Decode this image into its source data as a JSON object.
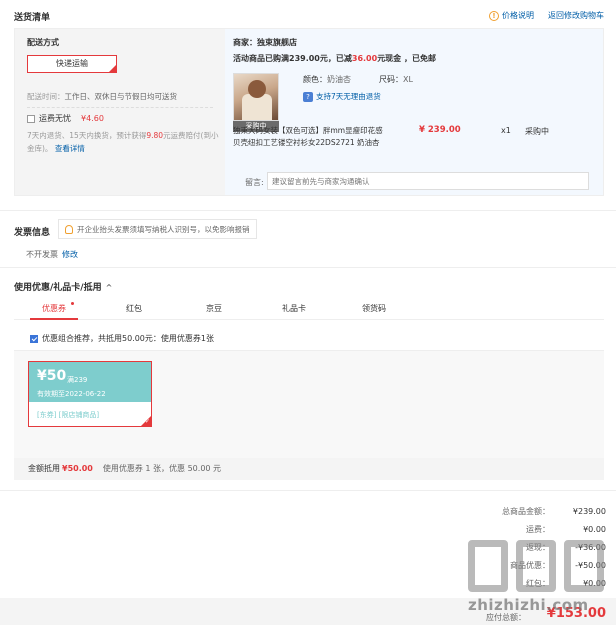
{
  "header": {
    "title": "送货清单",
    "price_info": "价格说明",
    "return_cart": "返回修改购物车"
  },
  "shipping": {
    "title": "配送方式",
    "method": "快递运输",
    "time_label": "配送时间：",
    "time_value": "工作日、双休日与节假日均可送货",
    "worry_label": "运费无忧",
    "worry_price": "¥4.60",
    "worry_desc_1": "7天内退货、15天内换货，预计获得",
    "worry_desc_red": "9.80",
    "worry_desc_2": "元运费赔付(到小金库)。",
    "worry_link": "查看详情"
  },
  "order": {
    "seller": "商家：独束旗舰店",
    "promo_1": "活动商品已购满239.00元，已减",
    "promo_red": "36.00",
    "promo_2": "元现金 ，已免邮",
    "color_k": "颜色：",
    "color_v": "奶油杏",
    "size_k": "尺码：",
    "size_v": "XL",
    "return_text": "支持7天无理由退货",
    "product_name": "独束大码女装【双色可选】胖mm显瘦印花感贝壳纽扣工艺镂空衬衫女22DS2721 奶油杏",
    "price": "¥ 239.00",
    "qty": "x1",
    "status": "采购中",
    "thumb_label": "采购中",
    "remark_label": "留言:",
    "remark_placeholder": "建议留言前先与商家沟通确认"
  },
  "invoice": {
    "title": "发票信息",
    "tip": "开企业抬头发票须填写纳税人识别号，以免影响报销",
    "value": "不开发票",
    "edit": "修改"
  },
  "coupons": {
    "title": "使用优惠/礼品卡/抵用",
    "chevron": "^",
    "tabs": [
      "优惠券",
      "红包",
      "京豆",
      "礼品卡",
      "领货码"
    ],
    "combo_text": "优惠组合推荐，共抵用50.00元：使用优惠券1张",
    "coupon": {
      "amount": "¥50",
      "condition": "满239",
      "date": "有效期至2022-06-22",
      "tags": "[东券]  [限店铺商品]"
    },
    "discount_label": "金额抵用",
    "discount_amount": "¥50.00",
    "discount_desc": "使用优惠券 1 张，优惠 50.00 元"
  },
  "totals": {
    "rows": [
      {
        "k": "总商品金额：",
        "v": "¥239.00"
      },
      {
        "k": "运费：",
        "v": "¥0.00"
      },
      {
        "k": "返现：",
        "v": "-¥36.00"
      },
      {
        "k": "商品优惠：",
        "v": "-¥50.00"
      },
      {
        "k": "红包：",
        "v": "¥0.00"
      }
    ],
    "pay_label": "应付总额：",
    "pay_value": "¥153.00"
  },
  "watermark": {
    "text": "zhizhizhi.com"
  },
  "colors": {
    "accent_red": "#e4393c",
    "link_blue": "#005ea7",
    "coupon_teal": "#7ecdcd"
  }
}
